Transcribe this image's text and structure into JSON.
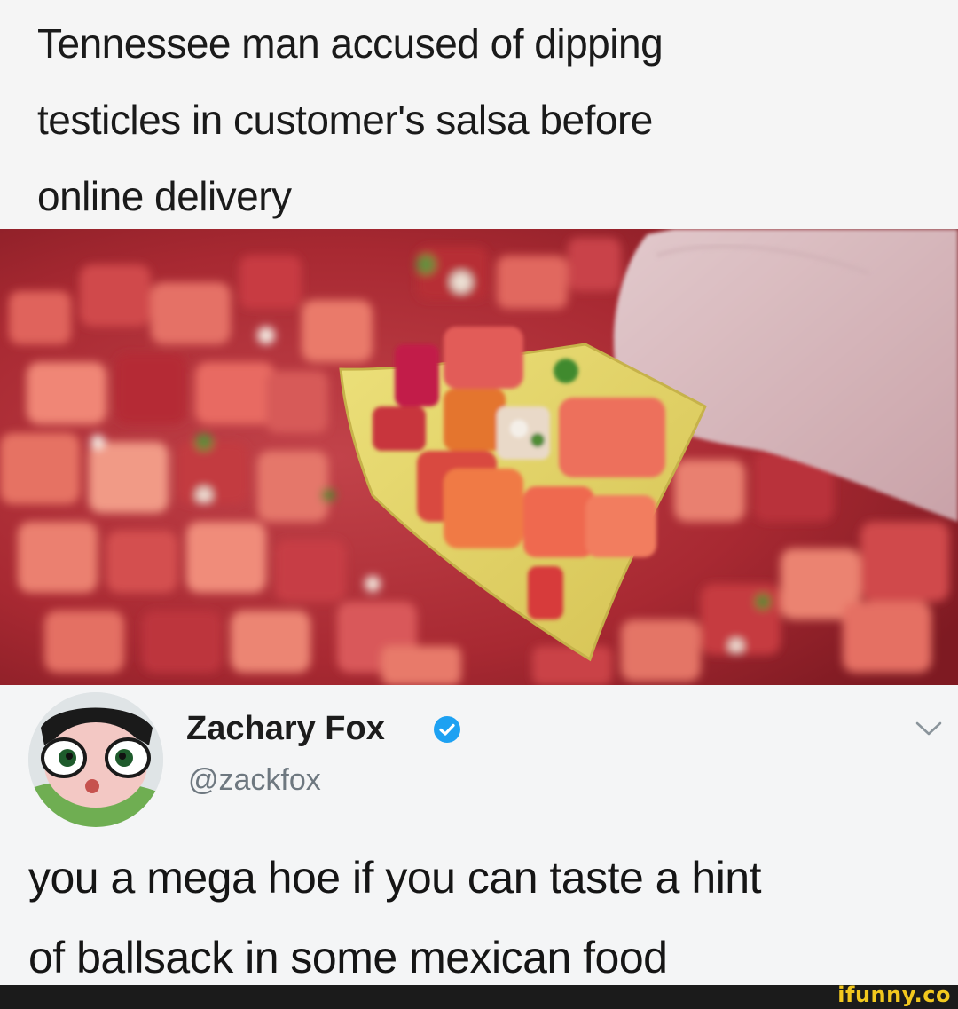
{
  "headline": {
    "line1": "Tennessee man accused of dipping",
    "line2": "testicles in customer's salsa before",
    "line3": "online delivery"
  },
  "photo": {
    "subject": "salsa-photo",
    "colors": {
      "salsa": "#b8323a",
      "chip": "#e3d36a",
      "finger": "#d8b8bc"
    }
  },
  "tweet": {
    "display_name": "Zachary Fox",
    "handle": "@zackfox",
    "verified": true,
    "text_line1": "you a mega hoe if you can taste a hint",
    "text_line2": "of ballsack in some mexican food",
    "colors": {
      "verified_badge": "#1da1f2",
      "handle": "#6e7880",
      "background": "#f4f5f6"
    }
  },
  "watermark": {
    "text": "ifunny.co",
    "color": "#f2c81e"
  }
}
